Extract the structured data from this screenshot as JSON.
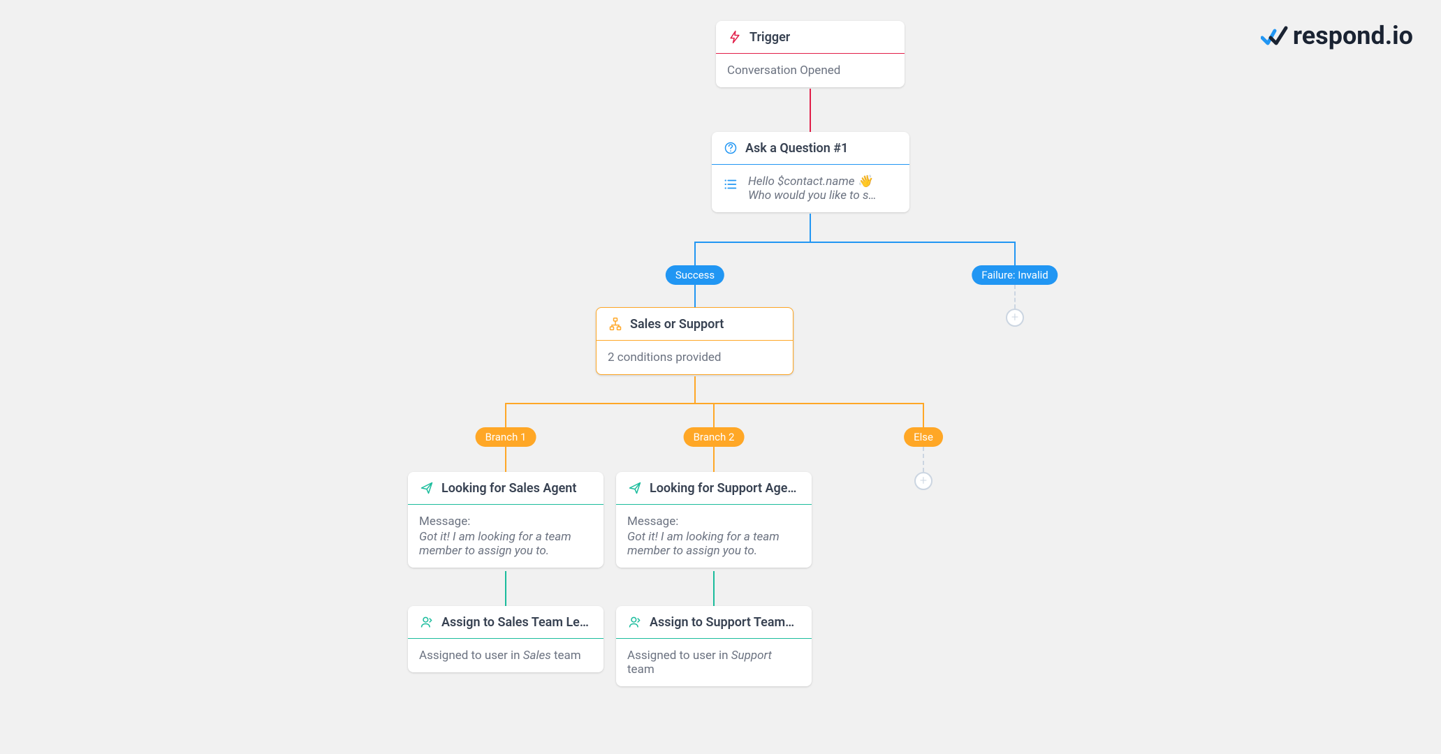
{
  "logo": {
    "text": "respond.io"
  },
  "nodes": {
    "trigger": {
      "title": "Trigger",
      "body": "Conversation Opened"
    },
    "question": {
      "title": "Ask a Question #1",
      "line1": "Hello $contact.name 👋",
      "line2": "Who would you like to s…"
    },
    "branches": {
      "success": "Success",
      "failure": "Failure: Invalid"
    },
    "condition": {
      "title": "Sales or Support",
      "body": "2 conditions provided"
    },
    "branchLabels": {
      "b1": "Branch 1",
      "b2": "Branch 2",
      "else": "Else"
    },
    "send1": {
      "title": "Looking for Sales Agent",
      "msgLabel": "Message:",
      "msg": "Got it! I am looking for a team member to assign you to."
    },
    "send2": {
      "title": "Looking for Support Age…",
      "msgLabel": "Message:",
      "msg": "Got it! I am looking for a team member to assign you to."
    },
    "assign1": {
      "title": "Assign to Sales Team Le…",
      "prefix": "Assigned to user in ",
      "team": "Sales",
      "suffix": " team"
    },
    "assign2": {
      "title": "Assign to Support Team…",
      "prefix": "Assigned to user in ",
      "team": "Support",
      "suffix": " team"
    }
  }
}
